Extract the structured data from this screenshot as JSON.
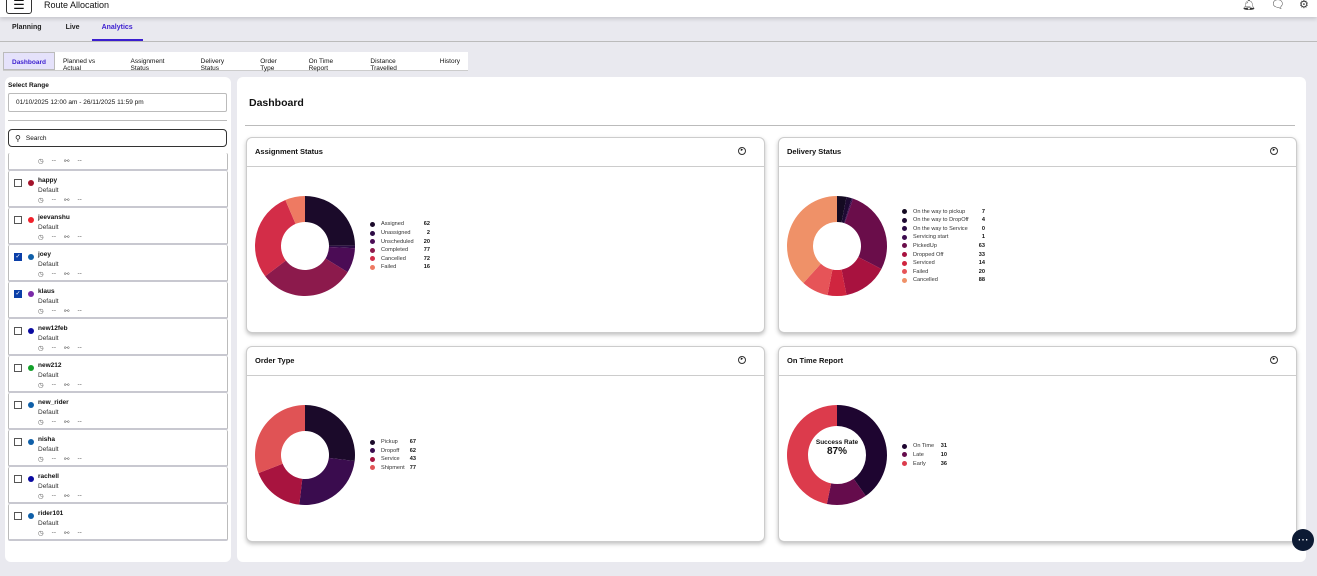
{
  "header": {
    "title": "Route Allocation",
    "icons": [
      "menu-icon",
      "bell-icon",
      "chat-icon",
      "gear-icon"
    ]
  },
  "nav_tabs": [
    {
      "label": "Planning"
    },
    {
      "label": "Live"
    },
    {
      "label": "Analytics",
      "active": true
    }
  ],
  "sub_tabs": [
    {
      "label": "Dashboard",
      "active": true
    },
    {
      "label": "Planned vs Actual"
    },
    {
      "label": "Assignment Status"
    },
    {
      "label": "Delivery Status"
    },
    {
      "label": "Order Type"
    },
    {
      "label": "On Time Report"
    },
    {
      "label": "Distance Travelled"
    },
    {
      "label": "History"
    }
  ],
  "sidebar": {
    "range_label": "Select Range",
    "range_value": "01/10/2025 12:00 am - 26/11/2025 11:59 pm",
    "search_placeholder": "Search",
    "riders": [
      {
        "name": "",
        "group": "",
        "time": "--",
        "route": "--",
        "partial": true
      },
      {
        "name": "happy",
        "group": "Default",
        "time": "--",
        "route": "--",
        "color": "#a3122a",
        "checked": false
      },
      {
        "name": "jeevanshu",
        "group": "Default",
        "time": "--",
        "route": "--",
        "color": "#f0202a",
        "checked": false
      },
      {
        "name": "joey",
        "group": "Default",
        "time": "--",
        "route": "--",
        "color": "#0f5fa8",
        "checked": true
      },
      {
        "name": "klaus",
        "group": "Default",
        "time": "--",
        "route": "--",
        "color": "#7b2aa8",
        "checked": true
      },
      {
        "name": "new12feb",
        "group": "Default",
        "time": "--",
        "route": "--",
        "color": "#0a0aa0",
        "checked": false
      },
      {
        "name": "new212",
        "group": "Default",
        "time": "--",
        "route": "--",
        "color": "#12a02a",
        "checked": false
      },
      {
        "name": "new_rider",
        "group": "Default",
        "time": "--",
        "route": "--",
        "color": "#0f5fa8",
        "checked": false
      },
      {
        "name": "nisha",
        "group": "Default",
        "time": "--",
        "route": "--",
        "color": "#0f5fa8",
        "checked": false
      },
      {
        "name": "rachell",
        "group": "Default",
        "time": "--",
        "route": "--",
        "color": "#0a0aa0",
        "checked": false
      },
      {
        "name": "rider101",
        "group": "Default",
        "time": "--",
        "route": "--",
        "color": "#0f5fa8",
        "checked": false
      }
    ]
  },
  "main": {
    "title": "Dashboard"
  },
  "chart_data": [
    {
      "type": "pie",
      "title": "Assignment Status",
      "donut": true,
      "categories": [
        "Assigned",
        "Unassigned",
        "Unscheduled",
        "Completed",
        "Cancelled",
        "Failed"
      ],
      "values": [
        62,
        2,
        20,
        77,
        72,
        16
      ],
      "colors": [
        "#1b0a2a",
        "#2c0b45",
        "#4b0c55",
        "#8c1a4c",
        "#d32d48",
        "#ee7a62"
      ]
    },
    {
      "type": "pie",
      "title": "Delivery Status",
      "donut": true,
      "categories": [
        "On the way to pickup",
        "On the way to DropOff",
        "On the way to Service",
        "Servicing start",
        "PickedUp",
        "Dropped Off",
        "Serviced",
        "Failed",
        "Cancelled"
      ],
      "values": [
        7,
        4,
        0,
        1,
        63,
        33,
        14,
        20,
        88
      ],
      "colors": [
        "#140a22",
        "#1e0a33",
        "#2a0b44",
        "#3c0c50",
        "#6a0d4a",
        "#a8123f",
        "#d0253f",
        "#e65458",
        "#ef9168"
      ]
    },
    {
      "type": "pie",
      "title": "Order Type",
      "donut": true,
      "categories": [
        "Pickup",
        "Dropoff",
        "Service",
        "Shipment"
      ],
      "values": [
        67,
        62,
        43,
        77
      ],
      "colors": [
        "#1b0a2a",
        "#3a0c4e",
        "#a8143f",
        "#e05355"
      ]
    },
    {
      "type": "pie",
      "title": "On Time Report",
      "donut": true,
      "categories": [
        "On Time",
        "Late",
        "Early"
      ],
      "values": [
        31,
        10,
        36
      ],
      "colors": [
        "#1e0530",
        "#650c4c",
        "#dc3b4c"
      ],
      "center_label": "Success Rate",
      "center_value": "87%"
    }
  ]
}
